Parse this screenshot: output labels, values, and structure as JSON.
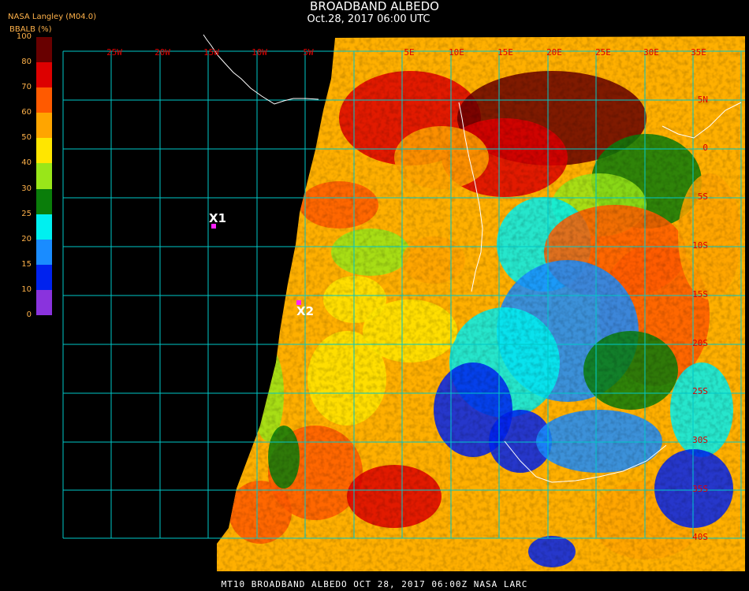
{
  "header": {
    "title": "BROADBAND ALBEDO",
    "subtitle": "Oct.28, 2017 06:00 UTC",
    "org": "NASA Langley (M04.0)"
  },
  "colorbar": {
    "title": "BBALB (%)",
    "ticks": [
      "100",
      "80",
      "70",
      "60",
      "50",
      "40",
      "30",
      "25",
      "20",
      "15",
      "10",
      "0"
    ],
    "colors": [
      "#680000",
      "#dd0000",
      "#ff5a00",
      "#ffa500",
      "#ffe600",
      "#99e619",
      "#0a7d0a",
      "#00f0f0",
      "#1a8cff",
      "#0022ee",
      "#8a33dd"
    ]
  },
  "map": {
    "lon_labels": [
      "25W",
      "20W",
      "15W",
      "10W",
      "5W",
      "5E",
      "10E",
      "15E",
      "20E",
      "25E",
      "30E",
      "35E"
    ],
    "lat_labels": [
      "5N",
      "0",
      "5S",
      "10S",
      "15S",
      "20S",
      "25S",
      "30S",
      "35S",
      "40S"
    ],
    "markers": [
      {
        "label": "X1",
        "color": "#ff22ff"
      },
      {
        "label": "X2",
        "color": "#ff22ff"
      }
    ]
  },
  "footer": "MT10  BROADBAND ALBEDO   OCT 28, 2017 06:00Z   NASA LARC"
}
